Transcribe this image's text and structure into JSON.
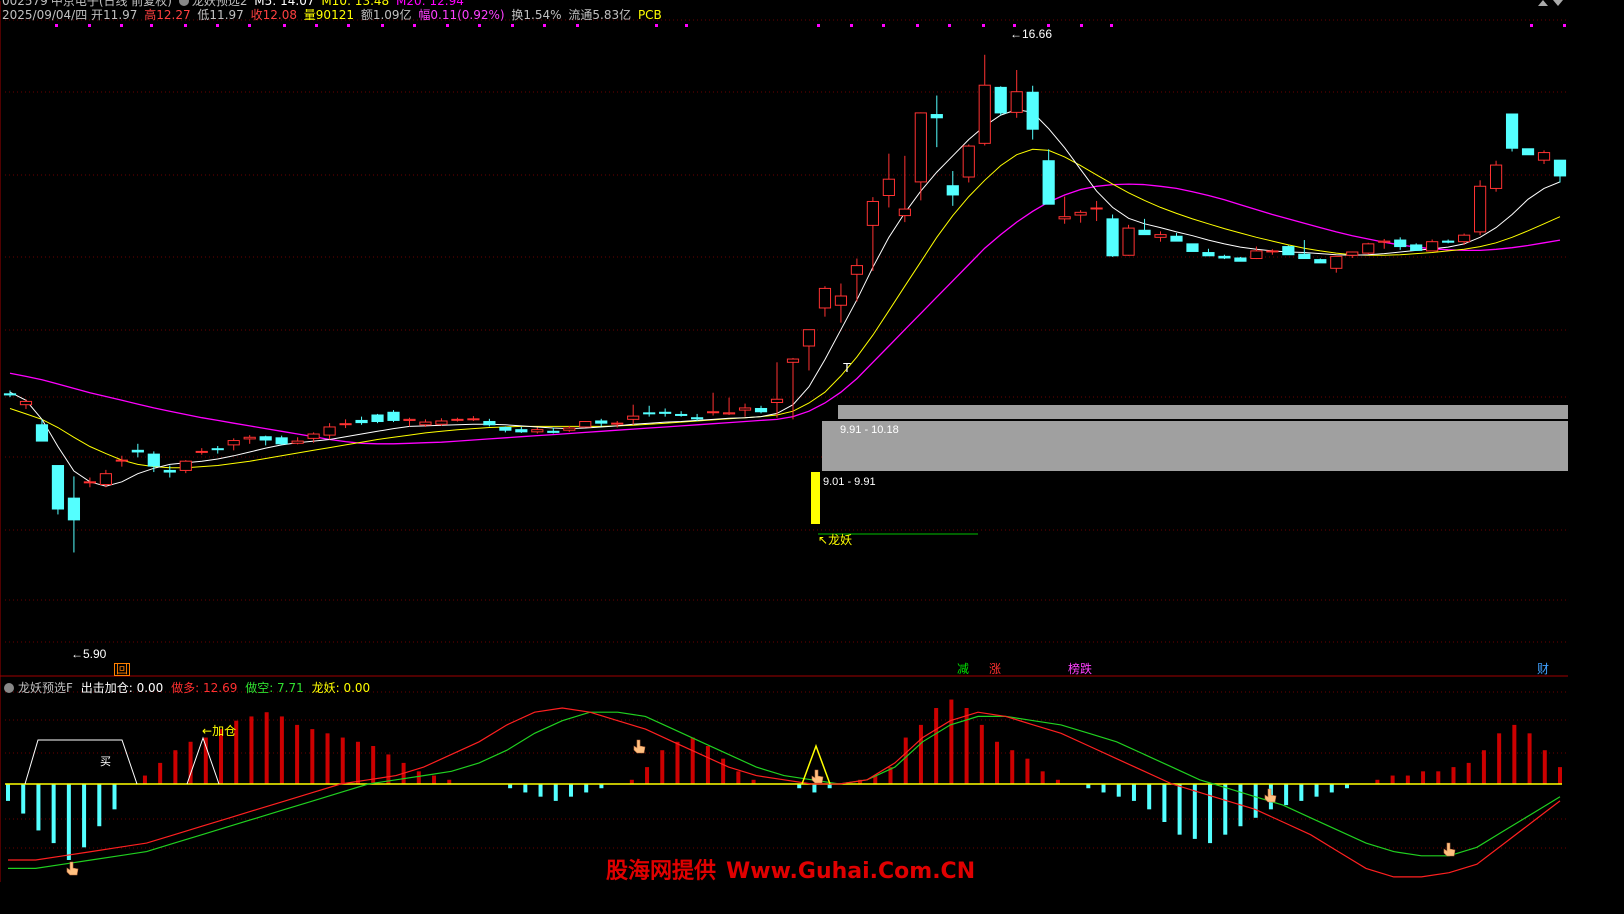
{
  "header": {
    "stock_code": "002579",
    "stock_name": "中京电子(日线 前复权)",
    "indicator": "龙妖预选2",
    "ma5": "M5: 14.07",
    "ma10": "M10: 13.48",
    "ma20": "M20: 12.94",
    "date": "2025/09/04/四",
    "open": "开11.97",
    "high": "高12.27",
    "low": "低11.97",
    "close": "收12.08",
    "volume": "量90121",
    "amount": "额1.09亿",
    "change": "幅0.11(0.92%)",
    "turnover": "换1.54%",
    "float_cap": "流通5.83亿",
    "sector": "PCB"
  },
  "annotations": {
    "high_label": "16.66",
    "low_label": "5.90",
    "zone_upper": "9.91 - 10.18",
    "zone_lower": "9.01 - 9.91",
    "longyao_tag": "龙妖",
    "t_mark": "T",
    "hui_marker": "回",
    "events": {
      "jian": "减",
      "zhang": "涨",
      "bangdie": "榜跌",
      "cai": "财"
    }
  },
  "sub_panel": {
    "title": "龙妖预选F",
    "out_add": "出击加仓: 0.00",
    "long": "做多: 12.69",
    "short": "做空: 7.71",
    "longyao": "龙妖: 0.00",
    "buy_label": "买",
    "add_label": "加仓"
  },
  "watermark": {
    "cn": "股海网提供",
    "url": "Www.Guhai.Com.CN"
  },
  "colors": {
    "bg": "#000000",
    "up": "#ff3232",
    "down": "#54ffff",
    "ma5": "#ffffff",
    "ma10": "#ffff00",
    "ma20": "#ff00ff",
    "grid": "#6b0000",
    "zone": "#a0a0a0",
    "hist_up": "#cc0000",
    "hist_down": "#54ffff",
    "line_red": "#ff2020",
    "line_green": "#20d020",
    "zero": "#ffff00",
    "watermark": "#e00000"
  },
  "chart_data": [
    {
      "type": "candlestick",
      "title": "中京电子(日线 前复权)",
      "ylim": [
        5.3,
        17.3
      ],
      "candles": [
        [
          10.42,
          10.48,
          10.36,
          10.4
        ],
        [
          10.22,
          10.32,
          10.14,
          10.28
        ],
        [
          9.85,
          9.95,
          9.55,
          9.55
        ],
        [
          9.1,
          9.1,
          8.2,
          8.3
        ],
        [
          8.5,
          8.9,
          7.5,
          8.1
        ],
        [
          8.8,
          8.88,
          8.7,
          8.8
        ],
        [
          8.75,
          9.02,
          8.7,
          8.95
        ],
        [
          9.2,
          9.28,
          9.08,
          9.2
        ],
        [
          9.38,
          9.5,
          9.25,
          9.35
        ],
        [
          9.31,
          9.36,
          8.98,
          9.09
        ],
        [
          9.01,
          9.1,
          8.88,
          8.98
        ],
        [
          9.01,
          9.2,
          8.96,
          9.18
        ],
        [
          9.35,
          9.42,
          9.3,
          9.36
        ],
        [
          9.41,
          9.46,
          9.32,
          9.4
        ],
        [
          9.48,
          9.6,
          9.38,
          9.56
        ],
        [
          9.59,
          9.66,
          9.5,
          9.62
        ],
        [
          9.63,
          9.65,
          9.47,
          9.57
        ],
        [
          9.61,
          9.65,
          9.48,
          9.5
        ],
        [
          9.51,
          9.62,
          9.49,
          9.55
        ],
        [
          9.6,
          9.71,
          9.52,
          9.68
        ],
        [
          9.66,
          9.88,
          9.58,
          9.81
        ],
        [
          9.87,
          9.95,
          9.79,
          9.87
        ],
        [
          9.93,
          10.0,
          9.85,
          9.89
        ],
        [
          10.03,
          10.05,
          9.88,
          9.91
        ],
        [
          10.08,
          10.12,
          9.9,
          9.93
        ],
        [
          9.93,
          9.98,
          9.82,
          9.95
        ],
        [
          9.85,
          9.95,
          9.81,
          9.9
        ],
        [
          9.86,
          9.97,
          9.83,
          9.92
        ],
        [
          9.94,
          9.98,
          9.91,
          9.95
        ],
        [
          9.96,
          10.01,
          9.92,
          9.96
        ],
        [
          9.91,
          9.96,
          9.82,
          9.85
        ],
        [
          9.8,
          9.82,
          9.71,
          9.75
        ],
        [
          9.76,
          9.81,
          9.7,
          9.72
        ],
        [
          9.72,
          9.8,
          9.69,
          9.76
        ],
        [
          9.73,
          9.8,
          9.69,
          9.71
        ],
        [
          9.75,
          9.83,
          9.72,
          9.79
        ],
        [
          9.81,
          9.92,
          9.8,
          9.91
        ],
        [
          9.92,
          9.96,
          9.82,
          9.88
        ],
        [
          9.87,
          9.92,
          9.8,
          9.88
        ],
        [
          9.95,
          10.22,
          9.85,
          10.01
        ],
        [
          10.07,
          10.2,
          10.0,
          10.06
        ],
        [
          10.08,
          10.15,
          10.0,
          10.06
        ],
        [
          10.04,
          10.1,
          10.0,
          10.03
        ],
        [
          9.98,
          10.05,
          9.92,
          9.96
        ],
        [
          10.08,
          10.44,
          10.02,
          10.09
        ],
        [
          10.05,
          10.35,
          10.03,
          10.07
        ],
        [
          10.12,
          10.24,
          10.0,
          10.16
        ],
        [
          10.15,
          10.2,
          10.06,
          10.09
        ],
        [
          10.26,
          11.0,
          9.98,
          10.32
        ],
        [
          11.0,
          11.08,
          9.95,
          11.06
        ],
        [
          11.3,
          11.6,
          10.85,
          11.6
        ],
        [
          12.0,
          12.4,
          11.84,
          12.36
        ],
        [
          12.05,
          12.45,
          11.73,
          12.22
        ],
        [
          12.62,
          12.91,
          12.12,
          12.78
        ],
        [
          13.52,
          14.04,
          12.68,
          13.96
        ],
        [
          14.07,
          14.84,
          13.85,
          14.37
        ],
        [
          13.7,
          14.8,
          13.58,
          13.82
        ],
        [
          14.32,
          15.6,
          13.98,
          15.59
        ],
        [
          15.56,
          15.91,
          14.96,
          15.5
        ],
        [
          14.25,
          14.52,
          13.88,
          14.08
        ],
        [
          14.41,
          15.01,
          14.31,
          14.98
        ],
        [
          15.03,
          16.66,
          14.99,
          16.1
        ],
        [
          16.06,
          16.08,
          15.55,
          15.59
        ],
        [
          15.6,
          16.38,
          15.5,
          15.98
        ],
        [
          15.97,
          16.09,
          15.1,
          15.29
        ],
        [
          14.71,
          14.92,
          14.01,
          13.91
        ],
        [
          13.64,
          14.05,
          13.55,
          13.68
        ],
        [
          13.71,
          13.8,
          13.57,
          13.76
        ],
        [
          13.84,
          13.97,
          13.6,
          13.84
        ],
        [
          13.64,
          13.72,
          12.94,
          12.96
        ],
        [
          12.97,
          13.53,
          12.96,
          13.47
        ],
        [
          13.43,
          13.64,
          13.4,
          13.35
        ],
        [
          13.3,
          13.41,
          13.22,
          13.35
        ],
        [
          13.32,
          13.38,
          13.25,
          13.23
        ],
        [
          13.18,
          13.18,
          13.05,
          13.04
        ],
        [
          13.02,
          13.09,
          12.96,
          12.96
        ],
        [
          12.95,
          12.98,
          12.9,
          12.92
        ],
        [
          12.92,
          12.94,
          12.86,
          12.86
        ],
        [
          12.91,
          13.13,
          12.9,
          13.05
        ],
        [
          13.05,
          13.08,
          12.98,
          13.05
        ],
        [
          13.13,
          13.15,
          13.01,
          12.98
        ],
        [
          12.99,
          13.25,
          12.92,
          12.91
        ],
        [
          12.89,
          12.91,
          12.83,
          12.83
        ],
        [
          12.73,
          12.94,
          12.65,
          12.95
        ],
        [
          12.97,
          13.04,
          12.92,
          13.03
        ],
        [
          13.01,
          13.2,
          12.99,
          13.18
        ],
        [
          13.21,
          13.27,
          13.09,
          13.23
        ],
        [
          13.25,
          13.3,
          13.07,
          13.13
        ],
        [
          13.16,
          13.19,
          13.05,
          13.06
        ],
        [
          13.05,
          13.26,
          13.05,
          13.22
        ],
        [
          13.23,
          13.26,
          13.19,
          13.21
        ],
        [
          13.22,
          13.37,
          13.16,
          13.34
        ],
        [
          13.4,
          14.35,
          13.34,
          14.24
        ],
        [
          14.2,
          14.71,
          14.14,
          14.63
        ],
        [
          15.57,
          15.57,
          14.88,
          14.94
        ],
        [
          14.93,
          14.93,
          14.82,
          14.82
        ],
        [
          14.72,
          14.9,
          14.65,
          14.86
        ],
        [
          14.72,
          14.72,
          14.31,
          14.43
        ]
      ],
      "ma5": [
        10.45,
        10.3,
        9.95,
        9.45,
        9.0,
        8.8,
        8.72,
        8.8,
        8.95,
        9.05,
        9.12,
        9.15,
        9.18,
        9.22,
        9.28,
        9.35,
        9.42,
        9.48,
        9.52,
        9.55,
        9.58,
        9.63,
        9.68,
        9.73,
        9.78,
        9.82,
        9.83,
        9.84,
        9.85,
        9.86,
        9.86,
        9.85,
        9.83,
        9.81,
        9.79,
        9.78,
        9.79,
        9.81,
        9.83,
        9.86,
        9.88,
        9.9,
        9.91,
        9.93,
        9.95,
        9.97,
        9.98,
        10.0,
        10.06,
        10.22,
        10.55,
        11.05,
        11.6,
        12.15,
        12.75,
        13.3,
        13.75,
        14.15,
        14.5,
        14.8,
        15.1,
        15.35,
        15.55,
        15.65,
        15.6,
        15.3,
        14.95,
        14.55,
        14.15,
        13.85,
        13.65,
        13.55,
        13.48,
        13.4,
        13.33,
        13.25,
        13.18,
        13.12,
        13.08,
        13.05,
        13.03,
        13.02,
        13.0,
        12.98,
        12.97,
        12.98,
        13.0,
        13.03,
        13.06,
        13.09,
        13.12,
        13.18,
        13.3,
        13.48,
        13.72,
        14.0,
        14.2,
        14.32
      ],
      "ma10": [
        10.15,
        10.05,
        9.95,
        9.8,
        9.62,
        9.45,
        9.32,
        9.2,
        9.12,
        9.08,
        9.06,
        9.06,
        9.08,
        9.1,
        9.14,
        9.18,
        9.23,
        9.28,
        9.33,
        9.38,
        9.43,
        9.48,
        9.53,
        9.58,
        9.62,
        9.66,
        9.7,
        9.73,
        9.76,
        9.78,
        9.8,
        9.81,
        9.82,
        9.82,
        9.82,
        9.82,
        9.82,
        9.82,
        9.83,
        9.84,
        9.86,
        9.88,
        9.9,
        9.92,
        9.94,
        9.96,
        9.98,
        10.0,
        10.03,
        10.1,
        10.25,
        10.45,
        10.75,
        11.1,
        11.5,
        11.95,
        12.4,
        12.85,
        13.3,
        13.7,
        14.05,
        14.35,
        14.62,
        14.82,
        14.92,
        14.9,
        14.78,
        14.62,
        14.45,
        14.28,
        14.12,
        13.98,
        13.85,
        13.74,
        13.64,
        13.55,
        13.46,
        13.38,
        13.3,
        13.23,
        13.16,
        13.1,
        13.05,
        13.01,
        12.98,
        12.97,
        12.97,
        12.98,
        13.0,
        13.02,
        13.05,
        13.08,
        13.13,
        13.2,
        13.3,
        13.42,
        13.55,
        13.68
      ],
      "ma20": [
        10.8,
        10.74,
        10.68,
        10.6,
        10.52,
        10.44,
        10.37,
        10.3,
        10.23,
        10.16,
        10.1,
        10.04,
        9.98,
        9.93,
        9.88,
        9.83,
        9.78,
        9.73,
        9.68,
        9.63,
        9.58,
        9.54,
        9.51,
        9.5,
        9.5,
        9.51,
        9.52,
        9.53,
        9.55,
        9.57,
        9.59,
        9.61,
        9.63,
        9.65,
        9.67,
        9.69,
        9.71,
        9.73,
        9.75,
        9.77,
        9.79,
        9.81,
        9.83,
        9.85,
        9.87,
        9.89,
        9.91,
        9.93,
        9.95,
        10.0,
        10.1,
        10.25,
        10.45,
        10.7,
        11.0,
        11.3,
        11.6,
        11.9,
        12.2,
        12.5,
        12.8,
        13.1,
        13.35,
        13.58,
        13.78,
        13.95,
        14.08,
        14.18,
        14.24,
        14.27,
        14.28,
        14.27,
        14.24,
        14.2,
        14.14,
        14.07,
        13.99,
        13.9,
        13.81,
        13.72,
        13.64,
        13.56,
        13.48,
        13.4,
        13.33,
        13.27,
        13.21,
        13.16,
        13.12,
        13.09,
        13.07,
        13.06,
        13.06,
        13.08,
        13.11,
        13.15,
        13.2,
        13.25
      ]
    },
    {
      "type": "bar",
      "title": "龙妖预选F",
      "zero": 0,
      "ylim": [
        -25,
        20
      ],
      "histogram": [
        -4,
        -7,
        -11,
        -14,
        -18,
        -15,
        -10,
        -6,
        0,
        2,
        5,
        8,
        10,
        11,
        13,
        15,
        16,
        17,
        16,
        14,
        13,
        12,
        11,
        10,
        9,
        7,
        5,
        3,
        2,
        1,
        0,
        0,
        0,
        -1,
        -2,
        -3,
        -4,
        -3,
        -2,
        -1,
        0,
        1,
        4,
        8,
        10,
        11,
        9,
        6,
        3,
        1,
        0,
        0,
        -1,
        -2,
        -1,
        0,
        1,
        2,
        4,
        11,
        14,
        18,
        20,
        18,
        14,
        10,
        8,
        6,
        3,
        1,
        0,
        -1,
        -2,
        -3,
        -4,
        -6,
        -9,
        -12,
        -13,
        -14,
        -12,
        -10,
        -8,
        -6,
        -5,
        -4,
        -3,
        -2,
        -1,
        0,
        1,
        2,
        2,
        3,
        3,
        4,
        5,
        8,
        12,
        14,
        12,
        8,
        4
      ],
      "line_long": [
        -18,
        -18,
        -17,
        -16,
        -15,
        -14,
        -12,
        -10,
        -8,
        -6,
        -4,
        -2,
        0,
        1,
        2,
        4,
        7,
        10,
        14,
        17,
        18,
        17,
        15,
        13,
        10,
        7,
        4,
        2,
        1,
        0,
        0,
        1,
        5,
        11,
        15,
        17,
        16,
        14,
        12,
        9,
        6,
        3,
        0,
        -2,
        -4,
        -6,
        -9,
        -12,
        -16,
        -20,
        -22,
        -22,
        -21,
        -19,
        -14,
        -9,
        -4
      ],
      "line_short": [
        -20,
        -20,
        -19,
        -18,
        -17,
        -16,
        -14,
        -12,
        -10,
        -8,
        -6,
        -4,
        -2,
        0,
        1,
        2,
        3,
        5,
        8,
        12,
        15,
        17,
        17,
        16,
        13,
        10,
        7,
        4,
        2,
        1,
        0,
        1,
        4,
        10,
        14,
        16,
        16,
        15,
        14,
        12,
        10,
        7,
        4,
        1,
        -1,
        -3,
        -5,
        -8,
        -11,
        -14,
        -16,
        -17,
        -17,
        -15,
        -11,
        -7,
        -3
      ]
    }
  ]
}
